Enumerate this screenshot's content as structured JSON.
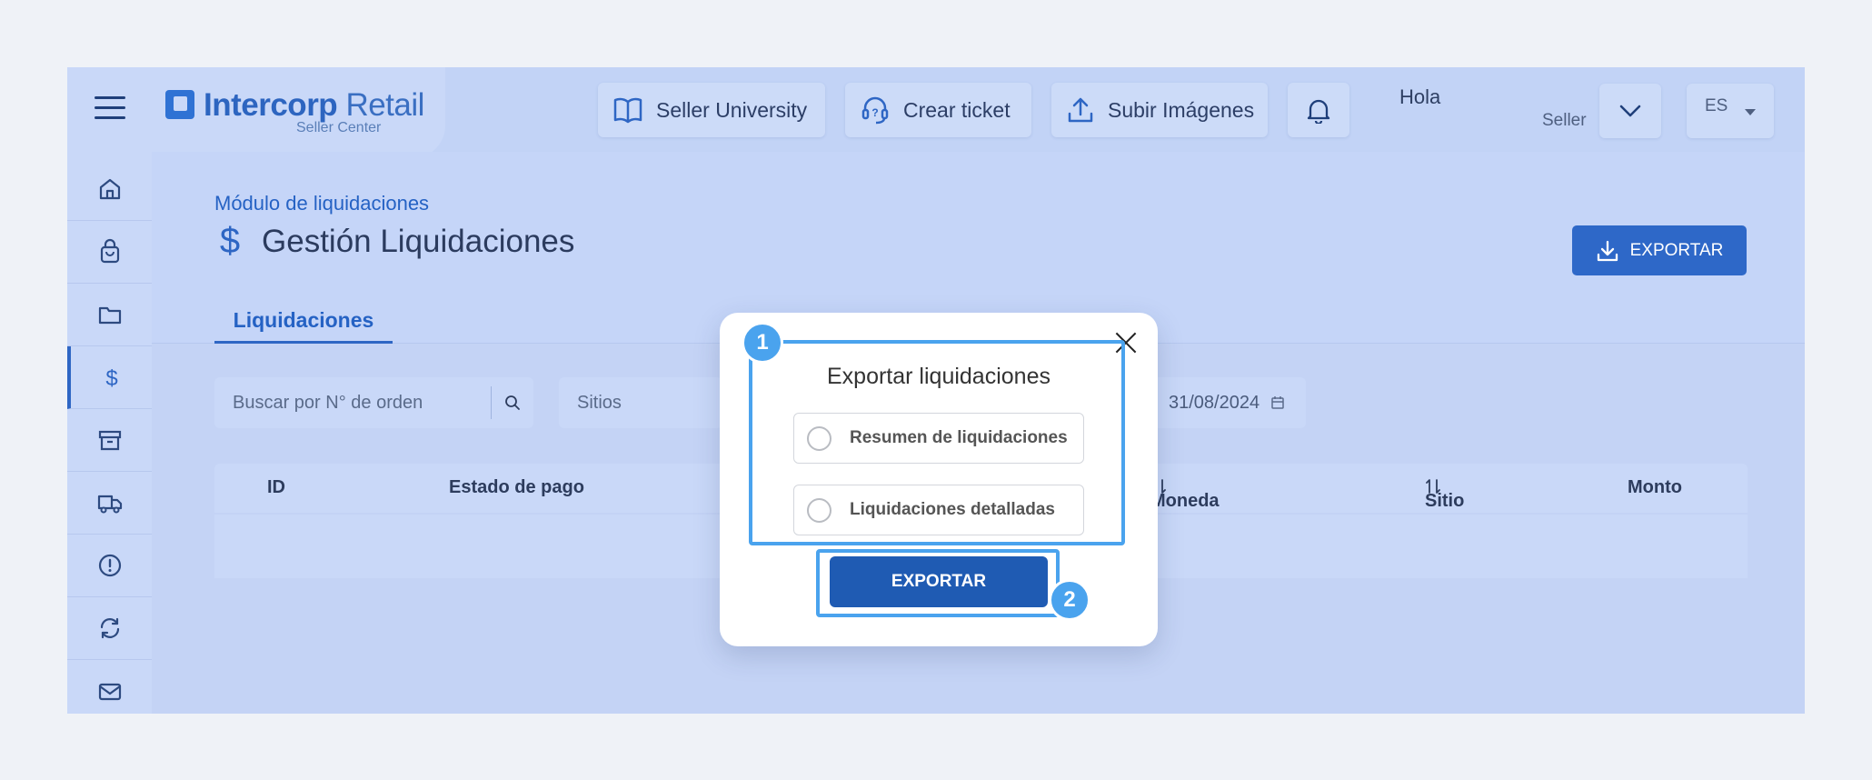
{
  "header": {
    "brand": "Intercorp",
    "brand_suffix": "Retail",
    "brand_sub": "Seller Center",
    "seller_university": "Seller University",
    "crear_ticket": "Crear ticket",
    "subir_imagenes": "Subir Imágenes",
    "greeting": "Hola",
    "role": "Seller",
    "language": "ES"
  },
  "sidebar": {
    "items": [
      "home-icon",
      "shopping-bag-icon",
      "folder-icon",
      "dollar-icon",
      "archive-icon",
      "truck-icon",
      "alert-icon",
      "refresh-icon",
      "mail-icon"
    ],
    "active_index": 3
  },
  "page": {
    "breadcrumb": "Módulo de liquidaciones",
    "title_icon": "$",
    "title": "Gestión Liquidaciones",
    "export_label": "EXPORTAR",
    "tab": "Liquidaciones"
  },
  "filters": {
    "search_placeholder": "Buscar por N° de orden",
    "sitios": "Sitios",
    "date_end": "31/08/2024"
  },
  "table": {
    "columns": {
      "id": "ID",
      "estado": "Estado de pago",
      "moneda": "Moneda",
      "sitio": "Sitio",
      "monto": "Monto"
    }
  },
  "modal": {
    "title": "Exportar liquidaciones",
    "option1": "Resumen de liquidaciones",
    "option2": "Liquidaciones detalladas",
    "export_label": "EXPORTAR",
    "callout1": "1",
    "callout2": "2"
  },
  "colors": {
    "accent": "#2e66c4",
    "callout": "#4aa3ee",
    "modal_button": "#1f5bb3"
  }
}
